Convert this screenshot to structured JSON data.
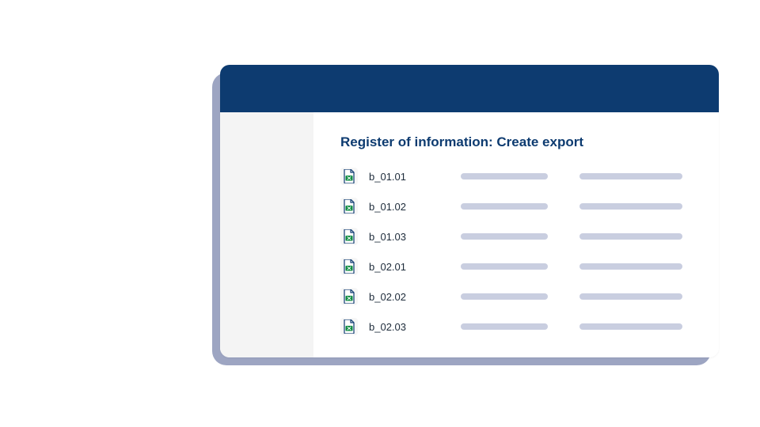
{
  "colors": {
    "header": "#0d3b70",
    "shadow": "#9da5c2",
    "placeholder": "#c9cee0",
    "sidebar": "#f4f4f4"
  },
  "page": {
    "title": "Register of information: Create export"
  },
  "files": [
    {
      "name": "b_01.01"
    },
    {
      "name": "b_01.02"
    },
    {
      "name": "b_01.03"
    },
    {
      "name": "b_02.01"
    },
    {
      "name": "b_02.02"
    },
    {
      "name": "b_02.03"
    }
  ]
}
